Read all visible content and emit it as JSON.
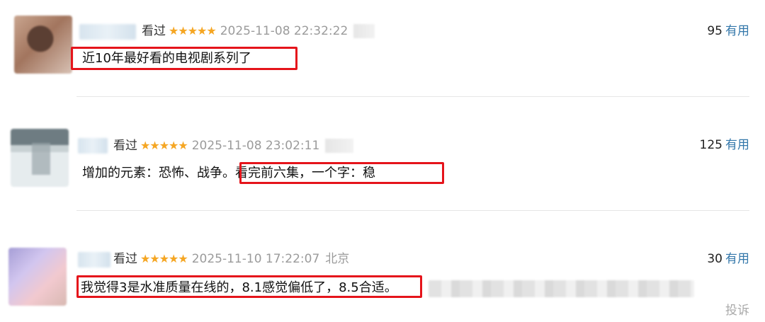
{
  "reviews": [
    {
      "status": "看过",
      "stars": "★★★★★",
      "time": "2025-11-08 22:32:22",
      "location": "",
      "useful_count": "95",
      "useful_label": "有用",
      "content_prefix": "",
      "content_highlight": "近10年最好看的电视剧系列了"
    },
    {
      "status": "看过",
      "stars": "★★★★★",
      "time": "2025-11-08 23:02:11",
      "location": "",
      "useful_count": "125",
      "useful_label": "有用",
      "content_prefix": "增加的元素：恐怖、战争。",
      "content_highlight": "看完前六集，一个字：稳"
    },
    {
      "status": "看过",
      "stars": "★★★★★",
      "time": "2025-11-10 17:22:07",
      "location": "北京",
      "useful_count": "30",
      "useful_label": "有用",
      "content_prefix": "",
      "content_highlight": "我觉得3是水准质量在线的，8.1感觉偏低了，8.5合适。"
    }
  ],
  "footer": {
    "report_label": "投诉"
  },
  "colors": {
    "star": "#f5a623",
    "link": "#3377aa",
    "highlight_border": "#e5141b",
    "meta_gray": "#9b9b9b"
  }
}
